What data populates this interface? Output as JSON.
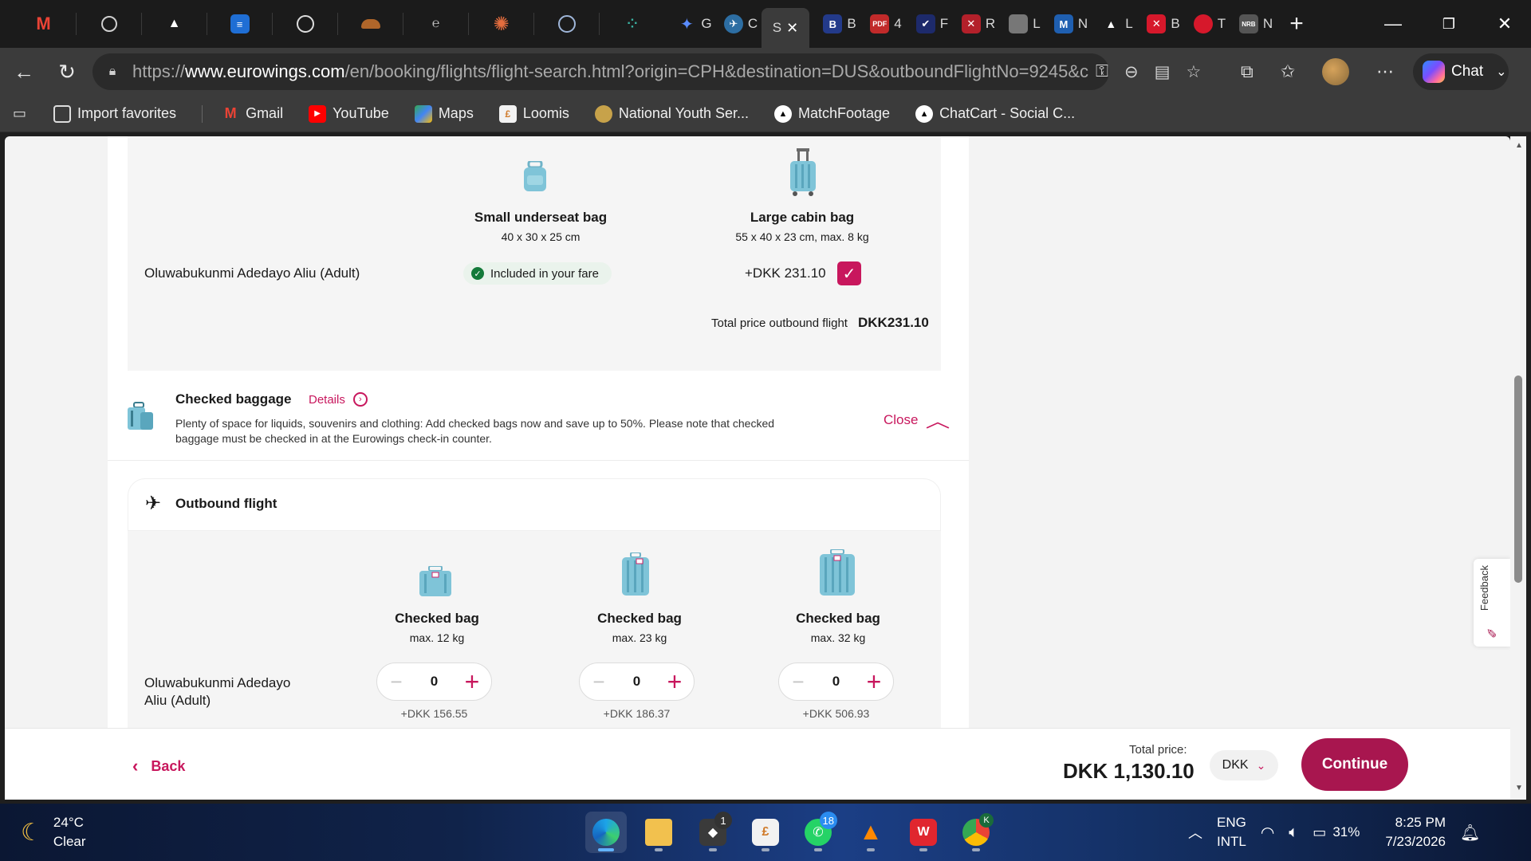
{
  "browser": {
    "tabs": [
      {
        "icon": "gmail-icon",
        "label": ""
      },
      {
        "icon": "openai-icon",
        "label": ""
      },
      {
        "icon": "triangle-icon",
        "label": ""
      },
      {
        "icon": "stack-icon",
        "label": ""
      },
      {
        "icon": "github-icon",
        "label": ""
      },
      {
        "icon": "cloud-icon",
        "label": ""
      },
      {
        "icon": "circle-e-icon",
        "label": ""
      },
      {
        "icon": "claude-icon",
        "label": ""
      },
      {
        "icon": "inbox-icon",
        "label": ""
      },
      {
        "icon": "dots-icon",
        "label": ""
      },
      {
        "icon": "gemini-icon",
        "label": "G"
      },
      {
        "icon": "compass-icon",
        "label": "C"
      },
      {
        "icon": "eurowings-icon",
        "label": "S"
      },
      {
        "icon": "b-icon",
        "label": "B"
      },
      {
        "icon": "pdf-icon",
        "label": "4"
      },
      {
        "icon": "check-icon",
        "label": "F"
      },
      {
        "icon": "x-red-icon",
        "label": "R"
      },
      {
        "icon": "image-icon",
        "label": "L"
      },
      {
        "icon": "m-icon",
        "label": "N"
      },
      {
        "icon": "triangle-icon",
        "label": "L"
      },
      {
        "icon": "x-red-icon",
        "label": "B"
      },
      {
        "icon": "turkish-icon",
        "label": "T"
      },
      {
        "icon": "nrb-icon",
        "label": "N"
      }
    ],
    "url_prefix": "https://",
    "url_host": "www.eurowings.com",
    "url_path": "/en/booking/flights/flight-search.html?origin=CPH&destination=DUS&outboundFlightNo=9245&c...",
    "chat_label": "Chat",
    "bookmarks": [
      {
        "label": "Import favorites",
        "icon": "import-icon"
      },
      {
        "label": "Gmail",
        "icon": "gmail-icon"
      },
      {
        "label": "YouTube",
        "icon": "youtube-icon"
      },
      {
        "label": "Maps",
        "icon": "maps-icon"
      },
      {
        "label": "Loomis",
        "icon": "loomis-icon"
      },
      {
        "label": "National Youth Ser...",
        "icon": "nysc-icon"
      },
      {
        "label": "MatchFootage",
        "icon": "triangle-icon"
      },
      {
        "label": "ChatCart - Social C...",
        "icon": "triangle-icon"
      }
    ]
  },
  "cabin": {
    "bag1_title": "Small underseat bag",
    "bag1_dims": "40 x 30 x 25 cm",
    "bag2_title": "Large cabin bag",
    "bag2_dims": "55 x 40 x 23 cm, max. 8 kg",
    "passenger": "Oluwabukunmi Adedayo Aliu (Adult)",
    "included_label": "Included in your fare",
    "bag2_price": "+DKK 231.10",
    "bag2_selected": true,
    "total_label": "Total price outbound flight",
    "total_value": "DKK231.10"
  },
  "checked": {
    "title": "Checked baggage",
    "details_label": "Details",
    "description_line1": "Plenty of space for liquids, souvenirs and clothing: Add checked bags now and save up to 50%. Please note that checked",
    "description_line2": "baggage must be checked in at the Eurowings check-in counter.",
    "close_label": "Close",
    "outbound_label": "Outbound flight",
    "passenger_line1": "Oluwabukunmi Adedayo",
    "passenger_line2": "Aliu (Adult)",
    "bags": [
      {
        "title": "Checked bag",
        "weight": "max. 12 kg",
        "qty": "0",
        "price": "+DKK 156.55"
      },
      {
        "title": "Checked bag",
        "weight": "max. 23 kg",
        "qty": "0",
        "price": "+DKK 186.37"
      },
      {
        "title": "Checked bag",
        "weight": "max. 32 kg",
        "qty": "0",
        "price": "+DKK 506.93"
      }
    ]
  },
  "footer": {
    "back_label": "Back",
    "total_label": "Total price:",
    "total_value": "DKK 1,130.10",
    "currency": "DKK",
    "continue_label": "Continue"
  },
  "feedback_label": "Feedback",
  "colors": {
    "accent": "#c8175d",
    "continue": "#a8164f",
    "bag_blue": "#7fc4d8"
  },
  "taskbar": {
    "weather_temp": "24°C",
    "weather_text": "Clear",
    "whatsapp_badge": "18",
    "terminal_badge": "1",
    "lang1": "ENG",
    "lang2": "INTL",
    "battery": "31%",
    "time": "8:25 PM",
    "date": "7/23/2026"
  }
}
